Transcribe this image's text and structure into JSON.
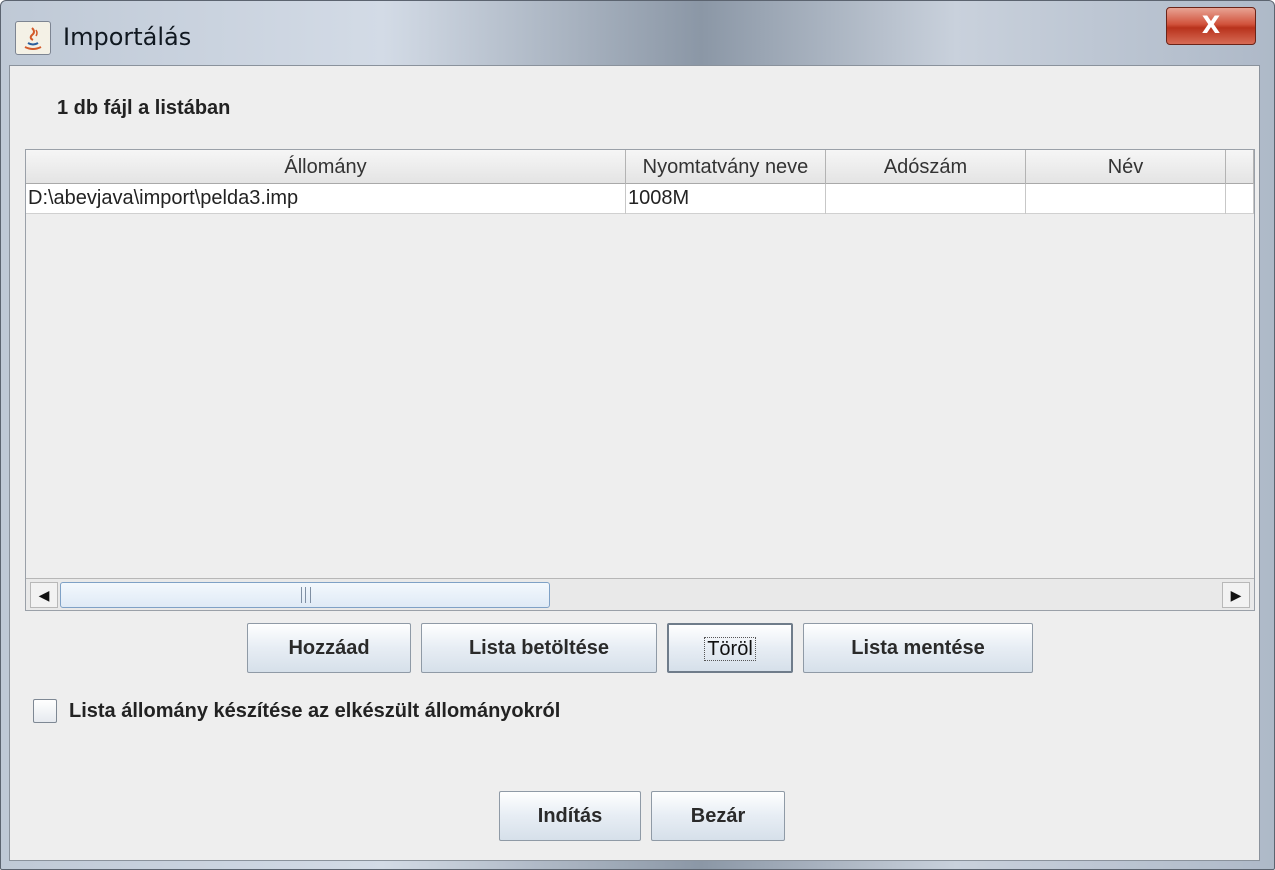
{
  "window": {
    "title": "Importálás",
    "close_label": "X"
  },
  "list": {
    "file_count": "1 db fájl a listában",
    "columns": [
      "Állomány",
      "Nyomtatvány neve",
      "Adószám",
      "Név"
    ],
    "rows": [
      {
        "file": "D:\\abevjava\\import\\pelda3.imp",
        "form": "1008M",
        "tax_id": "",
        "name": ""
      }
    ]
  },
  "buttons": {
    "add": "Hozzáad",
    "load_list": "Lista betöltése",
    "delete": "Töröl",
    "save_list": "Lista mentése",
    "start": "Indítás",
    "close": "Bezár"
  },
  "checkbox": {
    "label": "Lista állomány készítése az elkészült állományokról",
    "checked": false
  },
  "scrollbar": {
    "left_arrow": "◀",
    "right_arrow": "▶"
  }
}
